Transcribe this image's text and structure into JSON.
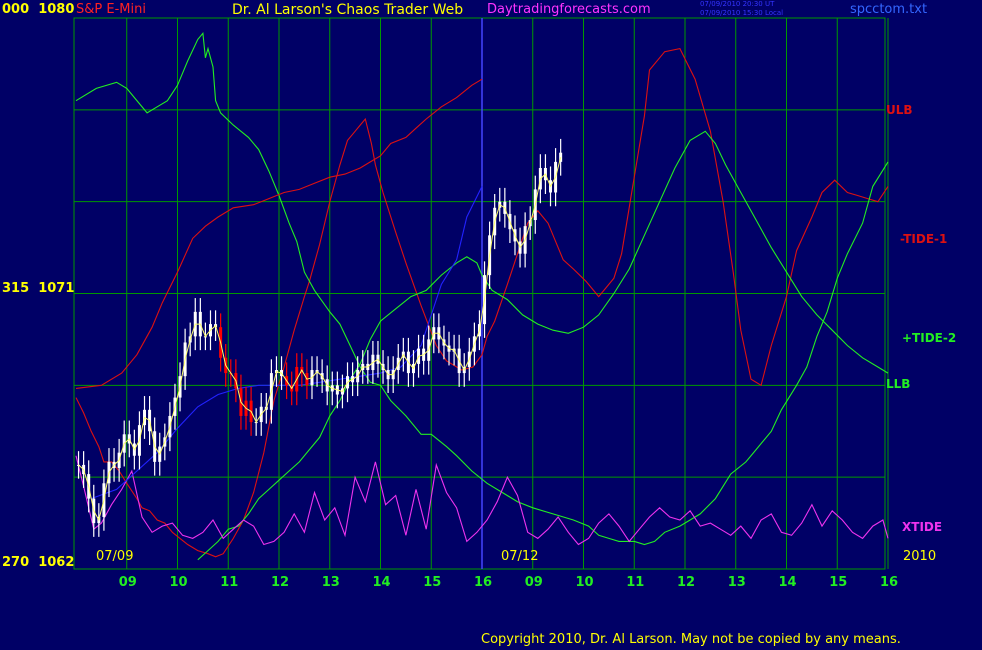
{
  "header": {
    "left_prefix": "000",
    "left_price": "1080",
    "instrument": "S&P E-Mini",
    "title": "Dr. Al Larson's Chaos Trader Web",
    "site": "Daytradingforecasts.com",
    "time_ut": "07/09/2010 20:30 UT",
    "time_local": "07/09/2010 15:30 Local",
    "filename": "spcctom.txt"
  },
  "y_axis": {
    "mid_prefix": "315",
    "mid_price": "1071",
    "low_prefix": "270",
    "low_price": "1062"
  },
  "labels": {
    "date1": "07/09",
    "date2": "07/12",
    "year": "2010",
    "ulb": "ULB",
    "tide1": "-TIDE-1",
    "tide2": "+TIDE-2",
    "llb": "LLB",
    "xtide": "XTIDE"
  },
  "copyright": "Copyright 2010, Dr. Al Larson. May not be copied by any means.",
  "colors": {
    "background": "#000066",
    "grid": "#009900",
    "title": "#ffff00",
    "site": "#ff33ff",
    "time": "#3333ff",
    "filename": "#3366ff",
    "instrument": "#ff2222",
    "price_label": "#ffff00",
    "tide1": "#dd1111",
    "tide2": "#22ee22",
    "xtide": "#ee33ee",
    "blue_line": "#2222ff",
    "bars": "#ffffff",
    "down_bars": "#ff0000",
    "avg": "#ffff66"
  },
  "chart_data": {
    "type": "line",
    "title": "S&P E-Mini",
    "x_tick_labels": [
      "09",
      "10",
      "11",
      "12",
      "13",
      "14",
      "15",
      "16",
      "09",
      "10",
      "11",
      "12",
      "13",
      "14",
      "15",
      "16"
    ],
    "date_labels": [
      "07/09",
      "07/12"
    ],
    "y_axis_labels": [
      1080,
      1071,
      1062
    ],
    "ylim": [
      1062,
      1080
    ],
    "grid": true,
    "forecast_curves": [
      {
        "name": "ULB",
        "label_y": 1077.3
      },
      {
        "name": "-TIDE-1",
        "label_y": 1074.4
      },
      {
        "name": "+TIDE-2",
        "label_y": 1069.5
      },
      {
        "name": "LLB",
        "label_y": 1068.2
      },
      {
        "name": "XTIDE",
        "label_y": 1063.5
      }
    ],
    "series": [
      {
        "name": "-TIDE-1",
        "x": [
          0.0,
          0.15,
          0.3,
          0.45,
          0.55,
          0.7,
          0.85,
          1.0,
          1.2,
          1.3,
          1.45,
          1.6,
          1.75,
          1.9,
          2.05,
          2.2,
          2.4,
          2.6,
          2.75,
          2.9,
          3.1,
          3.3,
          3.5,
          3.7,
          3.9,
          4.1,
          4.3,
          4.5,
          4.6,
          4.8,
          5.0,
          5.2,
          5.35,
          5.5,
          5.6,
          5.7,
          5.82,
          5.9,
          6.05,
          6.3,
          6.5,
          6.8,
          7.1,
          7.3,
          7.6,
          7.82,
          8.0,
          8.1,
          8.25,
          8.5,
          8.9,
          9.1,
          9.3,
          9.6,
          9.8,
          10.05,
          10.3,
          10.6,
          10.75,
          10.95,
          11.2,
          11.3,
          11.6,
          11.9,
          12.2,
          12.5,
          12.75,
          12.95,
          13.1,
          13.3,
          13.5,
          13.7,
          14.0,
          14.2,
          14.5,
          14.7,
          14.95,
          15.2,
          15.4,
          15.6,
          15.8,
          16.0
        ],
        "y": [
          1067.6,
          1067.1,
          1066.5,
          1066.0,
          1065.5,
          1065.5,
          1065.2,
          1064.8,
          1064.3,
          1064.0,
          1063.9,
          1063.6,
          1063.5,
          1063.2,
          1063.0,
          1062.8,
          1062.6,
          1062.5,
          1062.4,
          1062.5,
          1063.0,
          1063.6,
          1064.5,
          1065.8,
          1067.5,
          1068.6,
          1069.8,
          1070.9,
          1071.4,
          1072.6,
          1074.0,
          1075.2,
          1076.0,
          1076.3,
          1076.5,
          1076.7,
          1075.9,
          1075.2,
          1074.3,
          1073.0,
          1072.0,
          1070.6,
          1069.3,
          1068.8,
          1068.5,
          1068.6,
          1069.0,
          1069.6,
          1070.1,
          1071.3,
          1073.3,
          1073.7,
          1073.3,
          1072.1,
          1071.8,
          1071.4,
          1070.9,
          1071.5,
          1072.3,
          1074.3,
          1076.8,
          1078.3,
          1078.9,
          1079.0,
          1078.0,
          1076.3,
          1074.0,
          1071.7,
          1069.8,
          1068.2,
          1068.0,
          1069.3,
          1070.9,
          1072.4,
          1073.5,
          1074.3,
          1074.7,
          1074.3,
          1074.2,
          1074.1,
          1074.0,
          1074.5
        ]
      },
      {
        "name": "+TIDE-2",
        "x": [
          0.0,
          0.4,
          0.8,
          1.0,
          1.15,
          1.4,
          1.6,
          1.8,
          2.0,
          2.2,
          2.4,
          2.5,
          2.55,
          2.6,
          2.7,
          2.75,
          2.85,
          3.1,
          3.4,
          3.6,
          3.8,
          4.0,
          4.2,
          4.35,
          4.5,
          4.7,
          5.0,
          5.2,
          5.4,
          5.6,
          5.8,
          6.0,
          6.2,
          6.5,
          6.8,
          7.0,
          7.3,
          7.5,
          7.8,
          8.1,
          8.4,
          8.7,
          9.0,
          9.4,
          9.8,
          10.1,
          10.3,
          10.5,
          10.7,
          11.0,
          11.2,
          11.4,
          11.6,
          11.9,
          12.1,
          12.3,
          12.6,
          12.9,
          13.2,
          13.4,
          13.7,
          13.9,
          14.2,
          14.4,
          14.6,
          14.8,
          15.0,
          15.2,
          15.5,
          15.7,
          16.0
        ],
        "y": [
          1077.3,
          1077.7,
          1077.9,
          1077.7,
          1077.4,
          1076.9,
          1077.1,
          1077.3,
          1077.8,
          1078.6,
          1079.3,
          1079.5,
          1078.7,
          1079.0,
          1078.4,
          1077.3,
          1076.9,
          1076.5,
          1076.1,
          1075.7,
          1075.0,
          1074.2,
          1073.3,
          1072.7,
          1071.7,
          1071.1,
          1070.4,
          1070.0,
          1069.3,
          1068.6,
          1068.1,
          1068.0,
          1067.5,
          1067.0,
          1066.4,
          1066.4,
          1066.0,
          1065.7,
          1065.2,
          1064.8,
          1064.5,
          1064.2,
          1064.0,
          1063.8,
          1063.6,
          1063.4,
          1063.1,
          1063.0,
          1062.9,
          1062.9,
          1062.8,
          1062.9,
          1063.2,
          1063.4,
          1063.6,
          1063.8,
          1064.3,
          1065.1,
          1065.5,
          1065.9,
          1066.5,
          1067.2,
          1068.0,
          1068.6,
          1069.6,
          1070.4,
          1071.5,
          1072.3,
          1073.3,
          1074.5,
          1075.3
        ]
      },
      {
        "name": "LLB",
        "x": [
          2.4,
          2.6,
          2.8,
          3.0,
          3.2,
          3.4,
          3.6,
          3.8,
          4.0,
          4.2,
          4.4,
          4.6,
          4.8,
          5.0,
          5.2,
          5.4,
          5.6,
          5.8,
          6.0,
          6.3,
          6.6,
          6.9,
          7.2,
          7.5,
          7.7,
          7.9,
          8.0,
          8.2,
          8.5,
          8.8,
          9.1,
          9.4,
          9.7,
          10.0,
          10.3,
          10.6,
          10.9,
          11.2,
          11.5,
          11.8,
          12.1,
          12.4,
          12.6,
          12.8,
          13.1,
          13.4,
          13.7,
          14.0,
          14.3,
          14.6,
          14.9,
          15.2,
          15.5,
          15.8,
          16.0
        ],
        "y": [
          1062.3,
          1062.6,
          1062.9,
          1063.3,
          1063.4,
          1063.8,
          1064.3,
          1064.6,
          1064.9,
          1065.2,
          1065.5,
          1065.9,
          1066.3,
          1067.0,
          1067.5,
          1068.2,
          1068.7,
          1069.5,
          1070.1,
          1070.5,
          1070.9,
          1071.1,
          1071.6,
          1072.0,
          1072.2,
          1072.0,
          1071.6,
          1071.1,
          1070.8,
          1070.3,
          1070.0,
          1069.8,
          1069.7,
          1069.9,
          1070.3,
          1071.0,
          1071.8,
          1072.9,
          1074.0,
          1075.1,
          1076.0,
          1076.3,
          1075.9,
          1075.2,
          1074.3,
          1073.4,
          1072.5,
          1071.7,
          1070.9,
          1070.3,
          1069.8,
          1069.3,
          1068.9,
          1068.6,
          1068.4
        ]
      },
      {
        "name": "XTIDE",
        "x": [
          0.0,
          0.15,
          0.35,
          0.5,
          0.7,
          0.9,
          1.1,
          1.3,
          1.5,
          1.7,
          1.9,
          2.1,
          2.3,
          2.5,
          2.7,
          2.9,
          3.1,
          3.3,
          3.5,
          3.7,
          3.9,
          4.1,
          4.3,
          4.5,
          4.7,
          4.9,
          5.1,
          5.3,
          5.5,
          5.7,
          5.9,
          6.1,
          6.3,
          6.5,
          6.7,
          6.9,
          7.1,
          7.3,
          7.5,
          7.7,
          7.9,
          8.1,
          8.3,
          8.5,
          8.7,
          8.9,
          9.1,
          9.3,
          9.5,
          9.7,
          9.9,
          10.1,
          10.3,
          10.5,
          10.7,
          10.9,
          11.1,
          11.3,
          11.5,
          11.7,
          11.9,
          12.1,
          12.3,
          12.5,
          12.7,
          12.9,
          13.1,
          13.3,
          13.5,
          13.7,
          13.9,
          14.1,
          14.3,
          14.5,
          14.7,
          14.9,
          15.1,
          15.3,
          15.5,
          15.7,
          15.9,
          16.0
        ],
        "y": [
          1065.7,
          1064.7,
          1063.3,
          1063.5,
          1064.1,
          1064.6,
          1065.2,
          1063.7,
          1063.2,
          1063.4,
          1063.5,
          1063.1,
          1063.0,
          1063.2,
          1063.6,
          1063.0,
          1063.3,
          1063.6,
          1063.4,
          1062.8,
          1062.9,
          1063.2,
          1063.8,
          1063.2,
          1064.5,
          1063.6,
          1064.0,
          1063.1,
          1065.0,
          1064.2,
          1065.5,
          1064.1,
          1064.4,
          1063.1,
          1064.6,
          1063.3,
          1065.4,
          1064.5,
          1064.0,
          1062.9,
          1063.2,
          1063.6,
          1064.2,
          1065.0,
          1064.4,
          1063.2,
          1063.0,
          1063.3,
          1063.7,
          1063.2,
          1062.8,
          1063.0,
          1063.5,
          1063.8,
          1063.4,
          1062.9,
          1063.3,
          1063.7,
          1064.0,
          1063.7,
          1063.6,
          1063.9,
          1063.4,
          1063.5,
          1063.3,
          1063.1,
          1063.4,
          1063.0,
          1063.6,
          1063.8,
          1063.2,
          1063.1,
          1063.5,
          1064.1,
          1063.4,
          1063.9,
          1063.6,
          1063.2,
          1063.0,
          1063.4,
          1063.6,
          1063.0
        ]
      },
      {
        "name": "ULB",
        "x": [
          0.0,
          0.5,
          0.9,
          1.2,
          1.5,
          1.7,
          2.0,
          2.3,
          2.55,
          2.8,
          3.1,
          3.5,
          3.8,
          4.1,
          4.4,
          4.7,
          5.0,
          5.3,
          5.6,
          5.8,
          6.0,
          6.2,
          6.5,
          6.7,
          6.9,
          7.2,
          7.5,
          7.8,
          8.0
        ],
        "y": [
          1067.9,
          1068.0,
          1068.4,
          1069.0,
          1069.9,
          1070.7,
          1071.7,
          1072.8,
          1073.2,
          1073.5,
          1073.8,
          1073.9,
          1074.1,
          1074.3,
          1074.4,
          1074.6,
          1074.8,
          1074.9,
          1075.1,
          1075.3,
          1075.5,
          1075.9,
          1076.1,
          1076.4,
          1076.7,
          1077.1,
          1077.4,
          1077.8,
          1078.0
        ]
      },
      {
        "name": "Blue",
        "x": [
          0.3,
          0.8,
          1.2,
          1.6,
          2.0,
          2.4,
          2.8,
          3.2,
          3.6,
          4.0,
          4.4,
          4.8,
          5.2,
          5.6,
          6.0,
          6.4,
          6.8,
          7.2,
          7.5,
          7.7,
          8.0
        ],
        "y": [
          1064.3,
          1064.6,
          1065.2,
          1065.8,
          1066.6,
          1067.3,
          1067.7,
          1067.9,
          1068.0,
          1068.0,
          1068.0,
          1068.1,
          1068.2,
          1068.3,
          1068.4,
          1068.6,
          1069.3,
          1071.3,
          1072.1,
          1073.5,
          1074.5
        ]
      }
    ],
    "price_bars": {
      "x_step": 0.1,
      "x_start": 0.05,
      "close": [
        1065.4,
        1065.1,
        1064.3,
        1063.5,
        1063.7,
        1064.8,
        1065.5,
        1065.3,
        1065.8,
        1066.4,
        1066.1,
        1065.7,
        1066.7,
        1067.2,
        1066.5,
        1065.5,
        1066.0,
        1066.3,
        1067.0,
        1067.6,
        1068.3,
        1069.4,
        1069.6,
        1070.4,
        1069.6,
        1069.6,
        1070.0,
        1069.9,
        1068.9,
        1068.4,
        1068.4,
        1067.9,
        1067.0,
        1067.5,
        1066.8,
        1066.8,
        1067.3,
        1067.2,
        1068.4,
        1068.5,
        1068.3,
        1068.0,
        1067.8,
        1068.6,
        1068.4,
        1068.0,
        1068.5,
        1068.4,
        1068.2,
        1067.8,
        1068.0,
        1067.7,
        1067.9,
        1068.3,
        1068.1,
        1068.5,
        1068.7,
        1068.5,
        1069.0,
        1068.7,
        1068.5,
        1068.2,
        1068.5,
        1068.9,
        1069.1,
        1068.4,
        1068.7,
        1069.2,
        1068.8,
        1069.5,
        1069.9,
        1069.5,
        1069.3,
        1069.1,
        1069.2,
        1068.4,
        1068.6,
        1069.1,
        1069.6,
        1070.0,
        1071.6,
        1072.9,
        1073.8,
        1074.0,
        1073.6,
        1073.1,
        1072.7,
        1072.3,
        1073.2,
        1073.4,
        1074.4,
        1075.1,
        1074.7,
        1074.3,
        1075.3,
        1075.6
      ]
    }
  }
}
